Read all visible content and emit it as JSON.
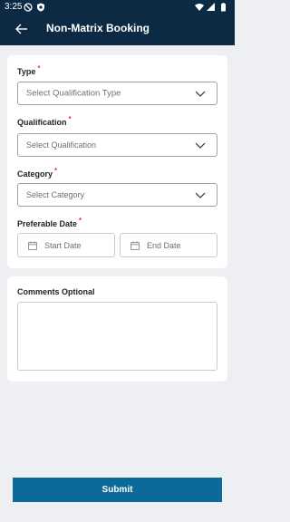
{
  "status_bar": {
    "time": "3:25"
  },
  "header": {
    "title": "Non-Matrix Booking"
  },
  "form": {
    "type": {
      "label": "Type",
      "required_mark": "*",
      "placeholder": "Select Qualification Type"
    },
    "qualification": {
      "label": "Qualification",
      "required_mark": "*",
      "placeholder": "Select Qualification"
    },
    "category": {
      "label": "Category",
      "required_mark": "*",
      "placeholder": "Select Category"
    },
    "preferable_date": {
      "label": "Preferable Date",
      "required_mark": "*",
      "start_placeholder": "Start Date",
      "end_placeholder": "End Date"
    }
  },
  "comments": {
    "label": "Comments Optional",
    "value": ""
  },
  "submit_label": "Submit",
  "colors": {
    "header_bg": "#0d2a44",
    "required": "#e23a44",
    "submit_bg": "#0c6a9a",
    "page_bg": "#eeeff3"
  }
}
